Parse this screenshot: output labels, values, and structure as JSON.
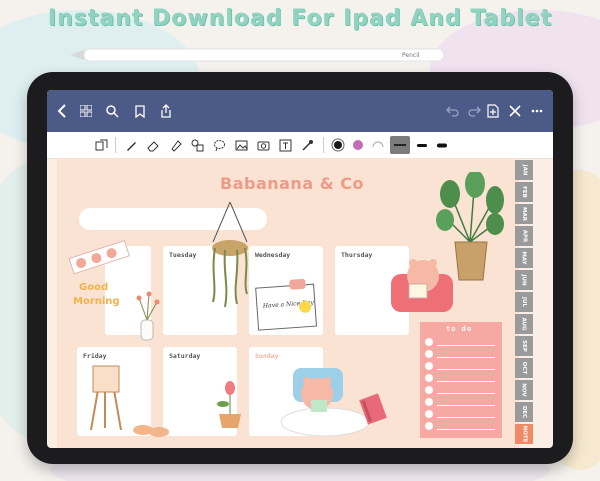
{
  "headline": "Instant Download For Ipad And Tablet",
  "pencil": {
    "brand": "Pencil"
  },
  "navbar": {
    "icons": [
      "back-chevron-icon",
      "grid-icon",
      "search-icon",
      "bookmark-icon",
      "share-icon",
      "undo-icon",
      "redo-icon",
      "add-page-icon",
      "close-icon",
      "more-icon"
    ]
  },
  "toolbar": {
    "tools": [
      "lasso-shapes-icon",
      "pen-icon",
      "eraser-icon",
      "highlighter-icon",
      "shape-icon",
      "lasso-icon",
      "image-icon",
      "camera-icon",
      "text-icon",
      "laser-icon"
    ],
    "colors": [
      "#1a1a1a",
      "#c66bb5",
      "#9a9a9a"
    ]
  },
  "planner": {
    "brand": "Babanana & Co",
    "days": {
      "tuesday": "Tuesday",
      "wednesday": "Wednesday",
      "thursday": "Thursday",
      "friday": "Friday",
      "saturday": "Saturday",
      "sunday": "Sunday"
    },
    "sticker_good_morning": "Good Morning",
    "note_card": "Have a Nice Day",
    "todo_title": "to do"
  },
  "months": [
    "JAN",
    "FEB",
    "MAR",
    "APR",
    "MAY",
    "JUN",
    "JUL",
    "AUG",
    "SEP",
    "OCT",
    "NOV",
    "DEC",
    "NOTE"
  ],
  "colors": {
    "accent": "#8fd3c0",
    "navbar": "#4b5a86",
    "page": "#fbe3d4",
    "brand": "#ef9a88",
    "todo": "#f6a9a2",
    "tab": "#9a9a9a",
    "note_tab": "#f08a66"
  }
}
